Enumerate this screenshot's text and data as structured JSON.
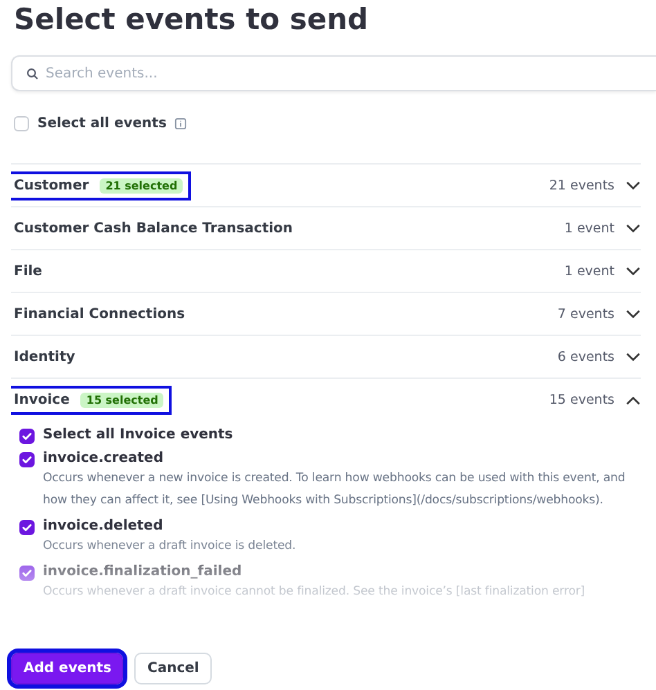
{
  "title": "Select events to send",
  "search": {
    "placeholder": "Search events..."
  },
  "select_all": {
    "label": "Select all events",
    "checked": false
  },
  "categories": [
    {
      "name": "Customer",
      "badge": "21 selected",
      "count": "21 events",
      "expanded": false,
      "highlighted": true
    },
    {
      "name": "Customer Cash Balance Transaction",
      "count": "1 event",
      "expanded": false,
      "highlighted": false
    },
    {
      "name": "File",
      "count": "1 event",
      "expanded": false,
      "highlighted": false
    },
    {
      "name": "Financial Connections",
      "count": "7 events",
      "expanded": false,
      "highlighted": false
    },
    {
      "name": "Identity",
      "count": "6 events",
      "expanded": false,
      "highlighted": false
    },
    {
      "name": "Invoice",
      "badge": "15 selected",
      "count": "15 events",
      "expanded": true,
      "highlighted": true,
      "events": [
        {
          "name": "Select all Invoice events",
          "checked": true
        },
        {
          "name": "invoice.created",
          "checked": true,
          "description": "Occurs whenever a new invoice is created. To learn how webhooks can be used with this event, and how they can affect it, see [Using Webhooks with Subscriptions](/docs/subscriptions/webhooks)."
        },
        {
          "name": "invoice.deleted",
          "checked": true,
          "description": "Occurs whenever a draft invoice is deleted."
        },
        {
          "name": "invoice.finalization_failed",
          "checked": true,
          "description": "Occurs whenever a draft invoice cannot be finalized. See the invoice’s [last finalization error]"
        }
      ]
    }
  ],
  "buttons": [
    {
      "label": "Add events",
      "kind": "primary",
      "highlighted": true
    },
    {
      "label": "Cancel",
      "kind": "secondary",
      "highlighted": false
    }
  ]
}
